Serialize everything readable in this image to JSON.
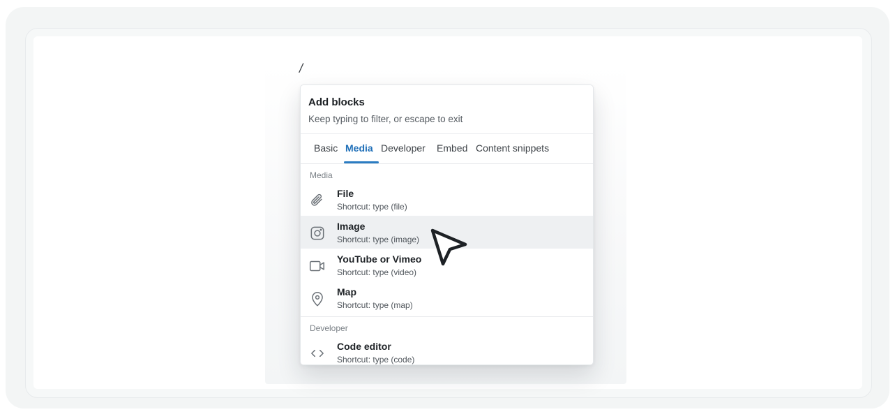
{
  "editor": {
    "typed_text": "/"
  },
  "popup": {
    "title": "Add blocks",
    "subtitle": "Keep typing to filter, or escape to exit",
    "tabs": [
      {
        "label": "Basic",
        "active": false
      },
      {
        "label": "Media",
        "active": true
      },
      {
        "label": "Developer",
        "active": false
      },
      {
        "label": "Embed",
        "active": false
      },
      {
        "label": "Content snippets",
        "active": false
      }
    ],
    "sections": [
      {
        "label": "Media",
        "items": [
          {
            "label": "File",
            "shortcut": "Shortcut: type (file)",
            "icon": "paperclip-icon"
          },
          {
            "label": "Image",
            "shortcut": "Shortcut: type (image)",
            "icon": "image-icon",
            "hovered": true
          },
          {
            "label": "YouTube or Vimeo",
            "shortcut": "Shortcut: type (video)",
            "icon": "video-camera-icon"
          },
          {
            "label": "Map",
            "shortcut": "Shortcut: type (map)",
            "icon": "map-pin-icon"
          }
        ]
      },
      {
        "label": "Developer",
        "items": [
          {
            "label": "Code editor",
            "shortcut": "Shortcut: type (code)",
            "icon": "code-brackets-icon"
          }
        ]
      }
    ]
  },
  "colors": {
    "accent": "#1f6fb8",
    "hover_row": "#eef0f2",
    "frame_bg": "#f3f5f5"
  }
}
